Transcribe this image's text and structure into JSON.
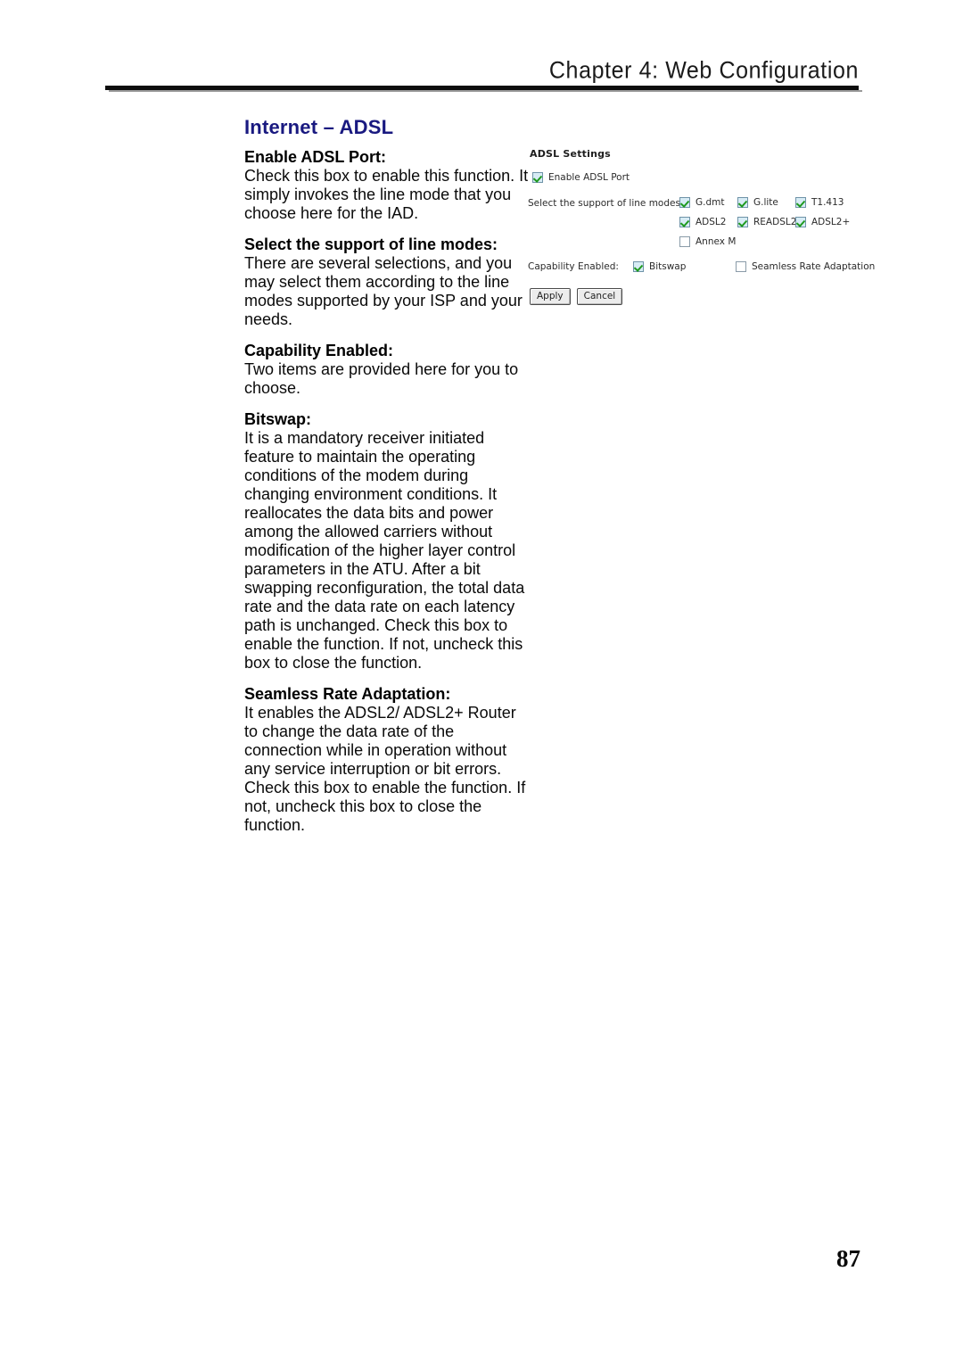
{
  "page": {
    "running_head": "Chapter  4:  Web  Configuration",
    "number": "87",
    "heading": "Internet – ADSL"
  },
  "glossary": [
    {
      "term": "Enable ADSL Port:",
      "body": "Check this box to enable this function. It simply invokes the line mode that you choose here for the IAD."
    },
    {
      "term": "Select the support of line modes:",
      "body": "There are several selections, and you may select them according to the line modes supported by your ISP and your needs."
    },
    {
      "term": "Capability Enabled:",
      "body": "Two items are provided here for you to choose."
    },
    {
      "term": "Bitswap:",
      "body": "It is a mandatory receiver initiated feature to maintain the operating conditions of the modem during changing environment conditions. It reallocates the data bits and power among the allowed carriers without modification of the higher layer control parameters in the ATU. After a bit swapping reconfiguration, the total data rate and the data rate on each latency path is unchanged. Check this box to enable the function. If not, uncheck this box to close the function."
    },
    {
      "term": "Seamless Rate Adaptation:",
      "body": "It enables the ADSL2/ ADSL2+ Router to change the data rate of the connection while in operation without any service interruption or bit errors. Check this box to enable the function. If not, uncheck this box to close the function."
    }
  ],
  "ui_screenshot": {
    "title": "ADSL Settings",
    "enable_port": {
      "label": "Enable ADSL Port",
      "checked": true
    },
    "line_modes": {
      "label": "Select the support of line modes:",
      "rows": [
        [
          {
            "label": "G.dmt",
            "checked": true
          },
          {
            "label": "G.lite",
            "checked": true
          },
          {
            "label": "T1.413",
            "checked": true
          }
        ],
        [
          {
            "label": "ADSL2",
            "checked": true
          },
          {
            "label": "READSL2",
            "checked": true
          },
          {
            "label": "ADSL2+",
            "checked": true
          }
        ],
        [
          {
            "label": "Annex M",
            "checked": false
          }
        ]
      ]
    },
    "capability": {
      "label": "Capability Enabled:",
      "bitswap": {
        "label": "Bitswap",
        "checked": true
      },
      "seamless_rate_adaptation": {
        "label": "Seamless Rate Adaptation",
        "checked": false
      }
    },
    "buttons": {
      "apply": "Apply",
      "cancel": "Cancel"
    }
  },
  "colors": {
    "heading": "#191980",
    "checkbox_fill": "#d7ecf5",
    "check_mark": "#1f9a1f",
    "rule": "#0d0d0d"
  }
}
